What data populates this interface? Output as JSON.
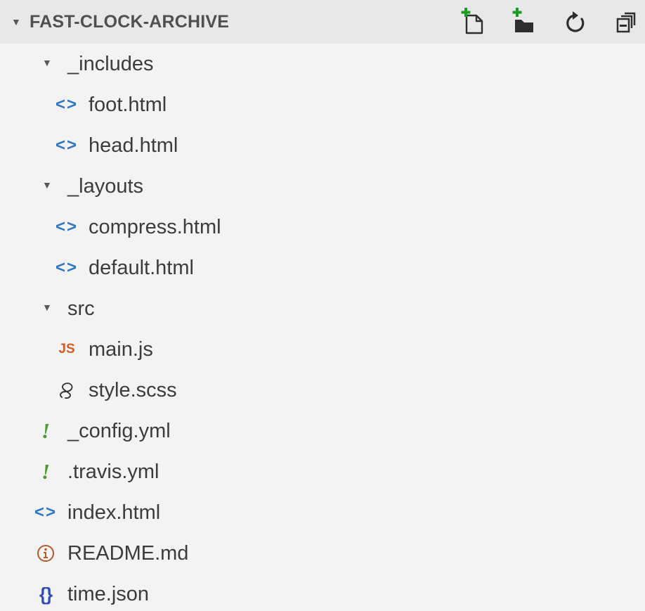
{
  "explorer": {
    "title": "FAST-CLOCK-ARCHIVE",
    "actions": [
      {
        "name": "new-file-icon"
      },
      {
        "name": "new-folder-icon"
      },
      {
        "name": "refresh-icon"
      },
      {
        "name": "collapse-all-icon"
      }
    ],
    "items": [
      {
        "label": "_includes",
        "type": "folder",
        "icon": "chevron-down-icon",
        "level": 1
      },
      {
        "label": "foot.html",
        "type": "html",
        "icon": "html-code-icon",
        "level": 2
      },
      {
        "label": "head.html",
        "type": "html",
        "icon": "html-code-icon",
        "level": 2
      },
      {
        "label": "_layouts",
        "type": "folder",
        "icon": "chevron-down-icon",
        "level": 1
      },
      {
        "label": "compress.html",
        "type": "html",
        "icon": "html-code-icon",
        "level": 2
      },
      {
        "label": "default.html",
        "type": "html",
        "icon": "html-code-icon",
        "level": 2
      },
      {
        "label": "src",
        "type": "folder",
        "icon": "chevron-down-icon",
        "level": 1
      },
      {
        "label": "main.js",
        "type": "js",
        "icon": "javascript-icon",
        "level": 2
      },
      {
        "label": "style.scss",
        "type": "scss",
        "icon": "sass-icon",
        "level": 2
      },
      {
        "label": "_config.yml",
        "type": "yml",
        "icon": "yaml-icon",
        "level": 1
      },
      {
        "label": ".travis.yml",
        "type": "yml",
        "icon": "yaml-icon",
        "level": 1
      },
      {
        "label": "index.html",
        "type": "html",
        "icon": "html-code-icon",
        "level": 1
      },
      {
        "label": "README.md",
        "type": "info",
        "icon": "info-icon",
        "level": 1
      },
      {
        "label": "time.json",
        "type": "json",
        "icon": "json-icon",
        "level": 1
      }
    ]
  },
  "colors": {
    "background": "#f3f3f3",
    "header_background": "#e8e8e8",
    "html_icon": "#2f76c0",
    "js_icon": "#cd5f27",
    "yml_icon": "#4c9b2f",
    "json_icon": "#2f4fb8",
    "info_icon": "#b45a28",
    "add_icon": "#1f9d22"
  }
}
